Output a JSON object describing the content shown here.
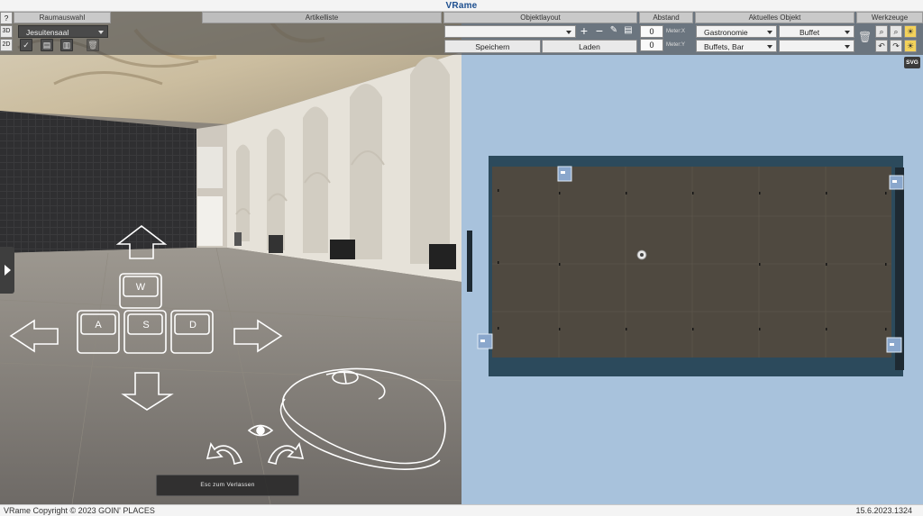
{
  "app": {
    "title_prefix": "V",
    "title_suffix": "Rame"
  },
  "toolbar": {
    "raumauswahl": {
      "header": "Raumauswahl",
      "room_value": "Jesuitensaal",
      "mode_3d": "3D",
      "mode_2d": "2D",
      "help_label": "?"
    },
    "artikelliste": {
      "header": "Artikelliste"
    },
    "objektlayout": {
      "header": "Objektlayout",
      "layout_value": "",
      "save_label": "Speichern",
      "load_label": "Laden"
    },
    "abstand": {
      "header": "Abstand",
      "x_value": "0",
      "y_value": "0",
      "x_unit": "Meter:X",
      "y_unit": "Meter:Y"
    },
    "aktuelles_objekt": {
      "header": "Aktuelles Objekt",
      "category_value": "Gastronomie",
      "subcategory_value": "Buffets, Bar",
      "object_value": "Buffet",
      "variant_value": ""
    },
    "werkzeuge": {
      "header": "Werkzeuge",
      "svg_label": "SVG"
    }
  },
  "viewport3d": {
    "keys": {
      "w": "W",
      "a": "A",
      "s": "S",
      "d": "D"
    },
    "esc_label": "Esc zum Verlassen"
  },
  "statusbar": {
    "copyright": "VRame Copyright © 2023 GOIN' PLACES",
    "version": "15.6.2023.1324"
  },
  "colors": {
    "accent": "#1c4e8f",
    "plan_background": "#a8c2dc",
    "plan_wall": "#2c4a5c",
    "plan_floor": "#4f4940"
  }
}
